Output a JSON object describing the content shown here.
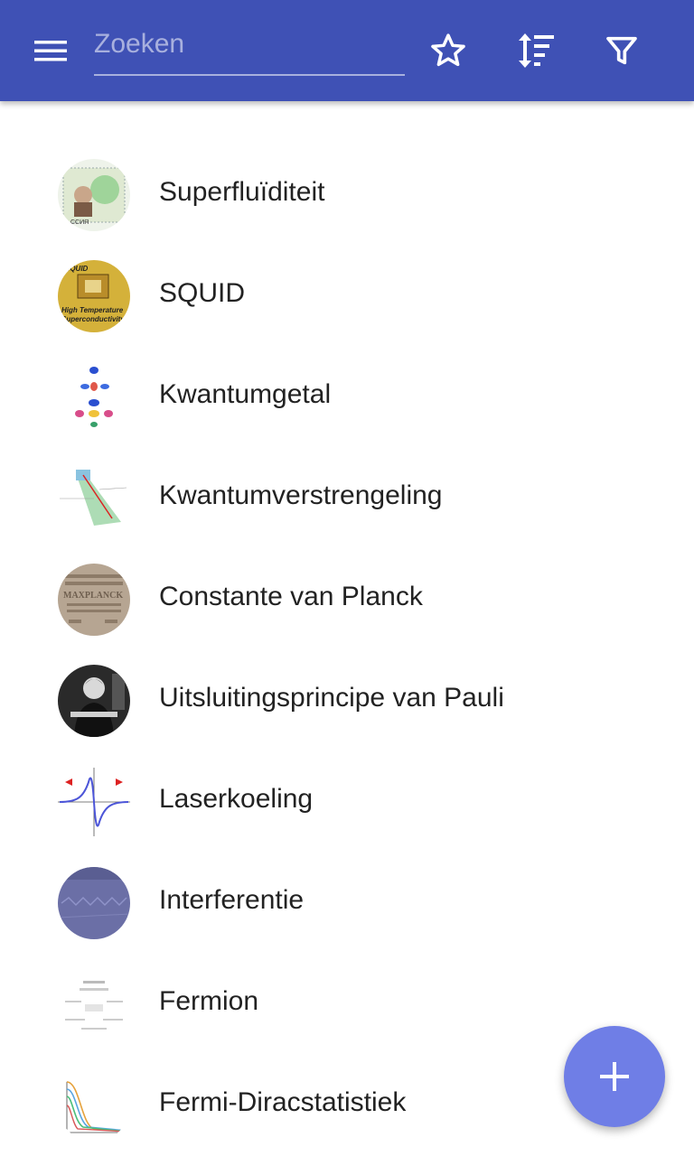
{
  "toolbar": {
    "menu_icon": "menu-icon",
    "search_placeholder": "Zoeken",
    "search_value": "",
    "favorites_icon": "star-outline-icon",
    "sort_icon": "sort-icon",
    "filter_icon": "filter-icon",
    "background_color": "#3f51b5"
  },
  "articles": [
    {
      "title": "Superfluïditeit"
    },
    {
      "title": "SQUID"
    },
    {
      "title": "Kwantumgetal"
    },
    {
      "title": "Kwantumverstrengeling"
    },
    {
      "title": "Constante van Planck"
    },
    {
      "title": "Uitsluitingsprincipe van Pauli"
    },
    {
      "title": "Laserkoeling"
    },
    {
      "title": "Interferentie"
    },
    {
      "title": "Fermion"
    },
    {
      "title": "Fermi-Diracstatistiek"
    }
  ],
  "fab": {
    "icon": "plus-icon",
    "color": "#6f7ee6"
  }
}
